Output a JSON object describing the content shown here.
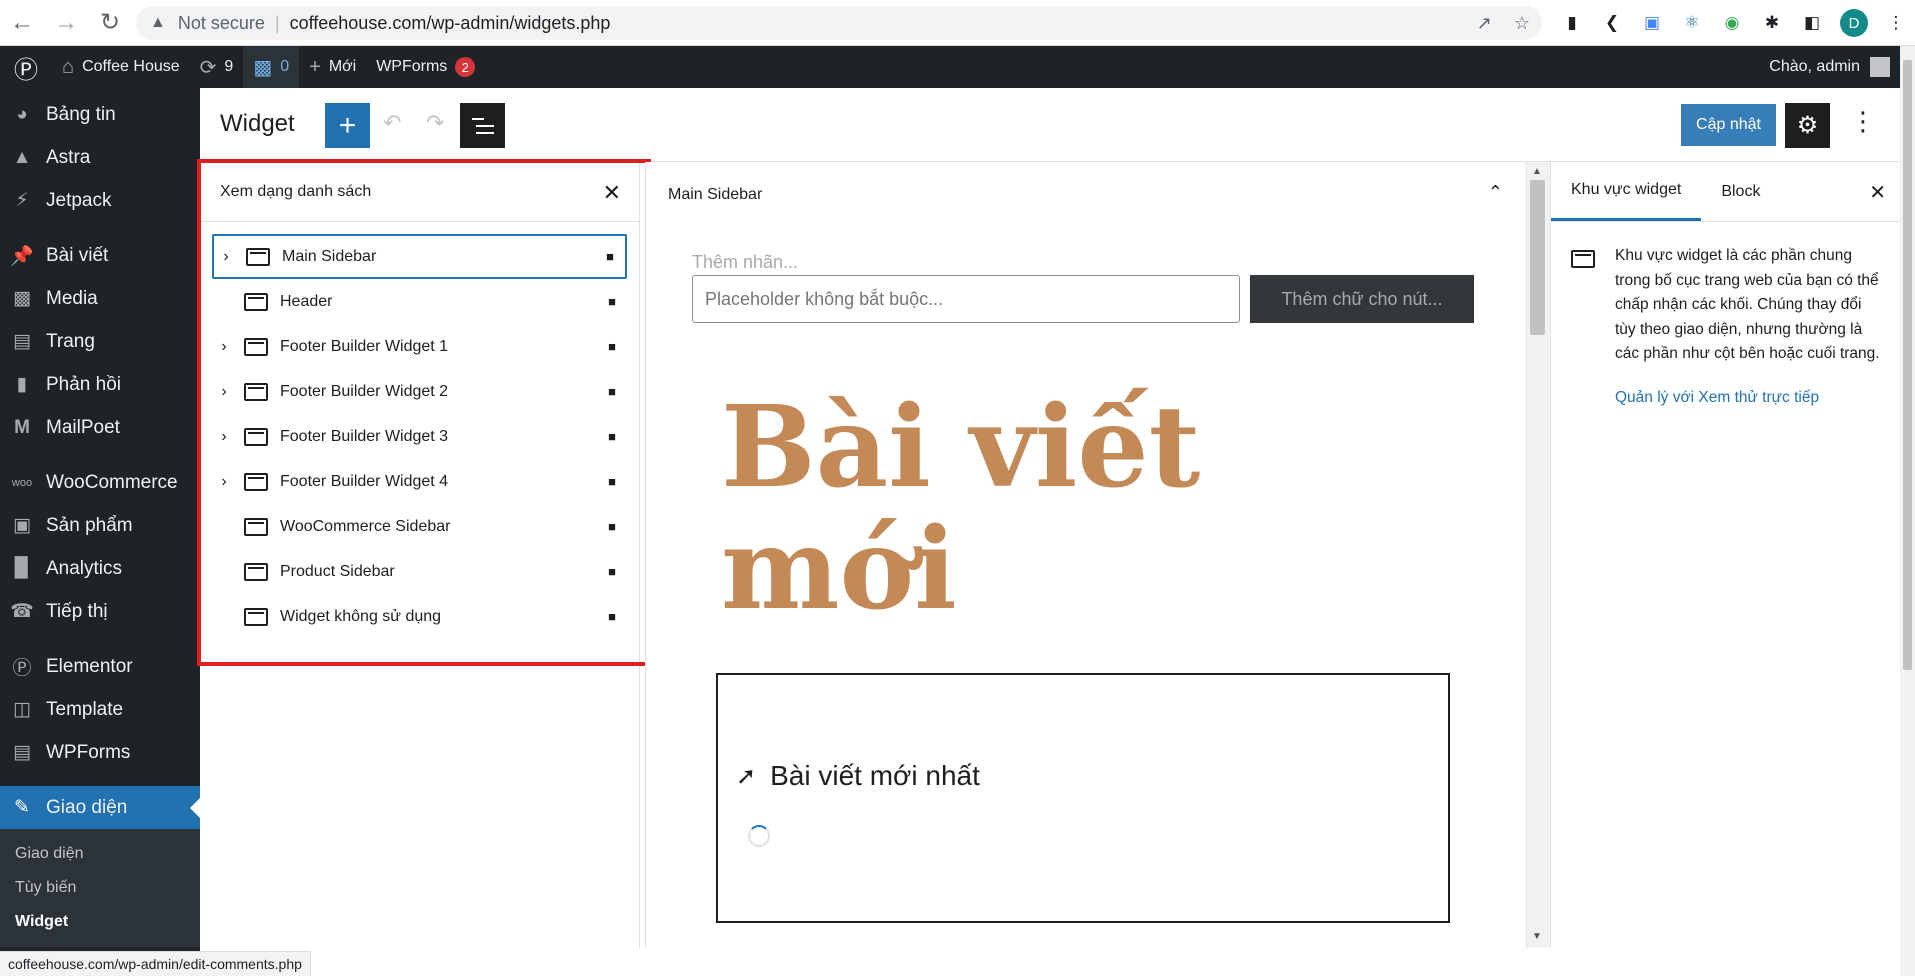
{
  "browser": {
    "security_text": "Not secure",
    "url": "coffeehouse.com/wp-admin/widgets.php",
    "profile_initial": "D",
    "status_url": "coffeehouse.com/wp-admin/edit-comments.php"
  },
  "adminbar": {
    "site_name": "Coffee House",
    "updates_count": "9",
    "comments_count": "0",
    "new_label": "Mới",
    "wpforms_label": "WPForms",
    "wpforms_badge": "2",
    "greeting": "Chào, admin"
  },
  "menu": {
    "items": [
      {
        "label": "Bảng tin",
        "icon": "dashboard-icon"
      },
      {
        "label": "Astra",
        "icon": "astra-icon"
      },
      {
        "label": "Jetpack",
        "icon": "jetpack-icon"
      },
      {
        "label": "Bài viết",
        "icon": "pin-icon"
      },
      {
        "label": "Media",
        "icon": "media-icon"
      },
      {
        "label": "Trang",
        "icon": "page-icon"
      },
      {
        "label": "Phản hồi",
        "icon": "comment-icon"
      },
      {
        "label": "MailPoet",
        "icon": "mailpoet-icon"
      },
      {
        "label": "WooCommerce",
        "icon": "woo-icon"
      },
      {
        "label": "Sản phẩm",
        "icon": "products-icon"
      },
      {
        "label": "Analytics",
        "icon": "analytics-icon"
      },
      {
        "label": "Tiếp thị",
        "icon": "marketing-icon"
      },
      {
        "label": "Elementor",
        "icon": "elementor-icon"
      },
      {
        "label": "Template",
        "icon": "folder-icon"
      },
      {
        "label": "WPForms",
        "icon": "wpforms-icon"
      },
      {
        "label": "Giao diện",
        "icon": "brush-icon"
      }
    ],
    "submenu": [
      "Giao diện",
      "Tùy biến",
      "Widget"
    ]
  },
  "editor": {
    "title": "Widget",
    "update_label": "Cập nhật"
  },
  "listview": {
    "title": "Xem dạng danh sách",
    "rows": [
      {
        "label": "Main Sidebar",
        "expandable": true,
        "selected": true
      },
      {
        "label": "Header",
        "expandable": false,
        "selected": false
      },
      {
        "label": "Footer Builder Widget 1",
        "expandable": true,
        "selected": false
      },
      {
        "label": "Footer Builder Widget 2",
        "expandable": true,
        "selected": false
      },
      {
        "label": "Footer Builder Widget 3",
        "expandable": true,
        "selected": false
      },
      {
        "label": "Footer Builder Widget 4",
        "expandable": true,
        "selected": false
      },
      {
        "label": "WooCommerce Sidebar",
        "expandable": false,
        "selected": false
      },
      {
        "label": "Product Sidebar",
        "expandable": false,
        "selected": false
      },
      {
        "label": "Widget không sử dụng",
        "expandable": false,
        "selected": false
      }
    ]
  },
  "canvas": {
    "area_title": "Main Sidebar",
    "search_label": "Thêm nhãn...",
    "search_placeholder": "Placeholder không bắt buộc...",
    "search_button": "Thêm chữ cho nút...",
    "heading": "Bài viết mới",
    "latest_posts_title": "Bài viết mới nhất",
    "heading_color": "#c38a58"
  },
  "settings": {
    "tab_widget_area": "Khu vực widget",
    "tab_block": "Block",
    "description": "Khu vực widget là các phần chung trong bố cục trang web của bạn có thể chấp nhận các khối. Chúng thay đổi tùy theo giao diện, nhưng thường là các phần như cột bên hoặc cuối trang.",
    "link": "Quản lý với Xem thử trực tiếp"
  },
  "colors": {
    "accent": "#2271b1",
    "admin_dark": "#1d2327",
    "highlight_red": "#e02020"
  }
}
